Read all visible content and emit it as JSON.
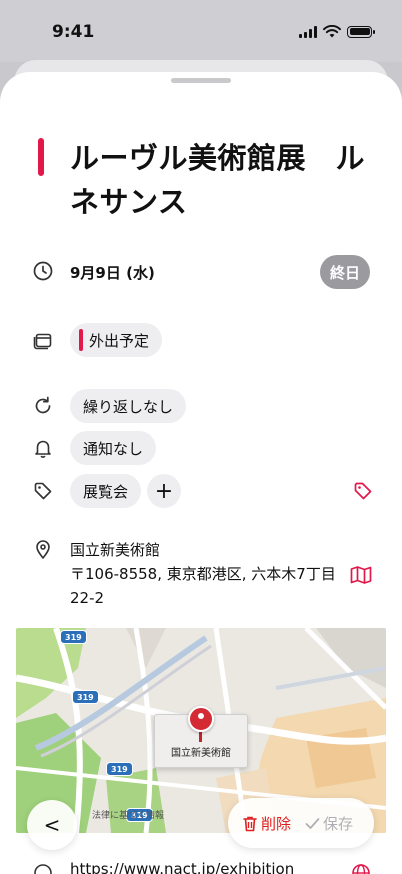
{
  "status_bar": {
    "time": "9:41"
  },
  "event": {
    "title": "ルーヴル美術館展　ルネサンス",
    "accent_color": "#e2174a",
    "date": "9月9日 (水)",
    "all_day_label": "終日",
    "calendar": "外出予定",
    "repeat": "繰り返しなし",
    "notification": "通知なし",
    "tag": "展覧会",
    "add_tag_label": "+",
    "location_name": "国立新美術館",
    "location_address": "〒106-8558, 東京都港区, 六本木7丁目22-2",
    "url": "https://www.nact.jp/exhibition"
  },
  "map": {
    "pin_label": "国立新美術館",
    "road_shields": [
      "319",
      "319",
      "319",
      "319"
    ],
    "legal_text": "法律に基づく情報"
  },
  "actions": {
    "back_label": "<",
    "delete_label": "削除",
    "save_label": "保存"
  },
  "icons": {
    "date": "clock-icon",
    "calendar": "calendar-icon",
    "repeat": "repeat-icon",
    "notification": "bell-icon",
    "tag": "tag-icon",
    "location": "location-pin-icon",
    "open_map": "map-icon",
    "url": "link-icon",
    "globe": "globe-icon"
  }
}
